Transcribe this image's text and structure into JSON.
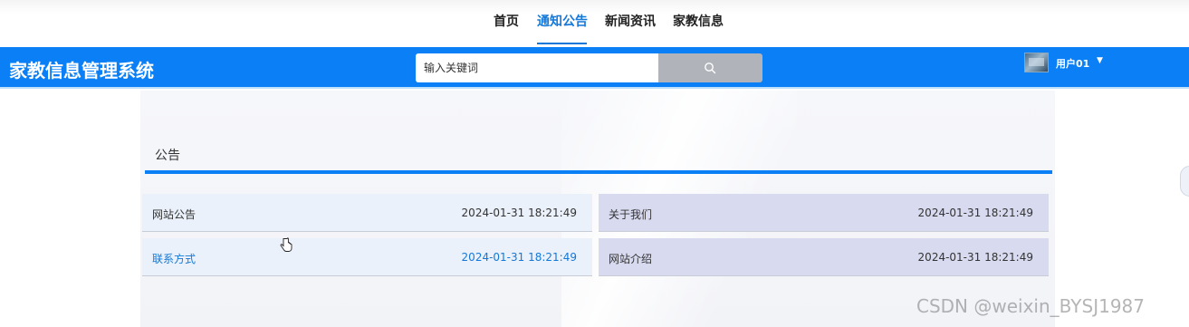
{
  "topnav": {
    "items": [
      {
        "label": "首页",
        "active": false
      },
      {
        "label": "通知公告",
        "active": true
      },
      {
        "label": "新闻资讯",
        "active": false
      },
      {
        "label": "家教信息",
        "active": false
      }
    ]
  },
  "header": {
    "title": "家教信息管理系统",
    "search": {
      "placeholder": "输入关键词",
      "value": "",
      "button_icon": "search-icon"
    },
    "user": {
      "name": "用户01",
      "avatar_icon": "avatar-image",
      "caret_icon": "caret-down-icon"
    }
  },
  "section": {
    "title": "公告",
    "items": [
      {
        "title": "网站公告",
        "date": "2024-01-31 18:21:49"
      },
      {
        "title": "关于我们",
        "date": "2024-01-31 18:21:49"
      },
      {
        "title": "联系方式",
        "date": "2024-01-31 18:21:49"
      },
      {
        "title": "网站介绍",
        "date": "2024-01-31 18:21:49"
      }
    ]
  },
  "watermark": "CSDN @weixin_BYSJ1987",
  "colors": {
    "accent": "#0a7ff6",
    "active_nav": "#1478d8",
    "card_light": "#eaf1fa",
    "card_lavender": "#d8daf0"
  }
}
